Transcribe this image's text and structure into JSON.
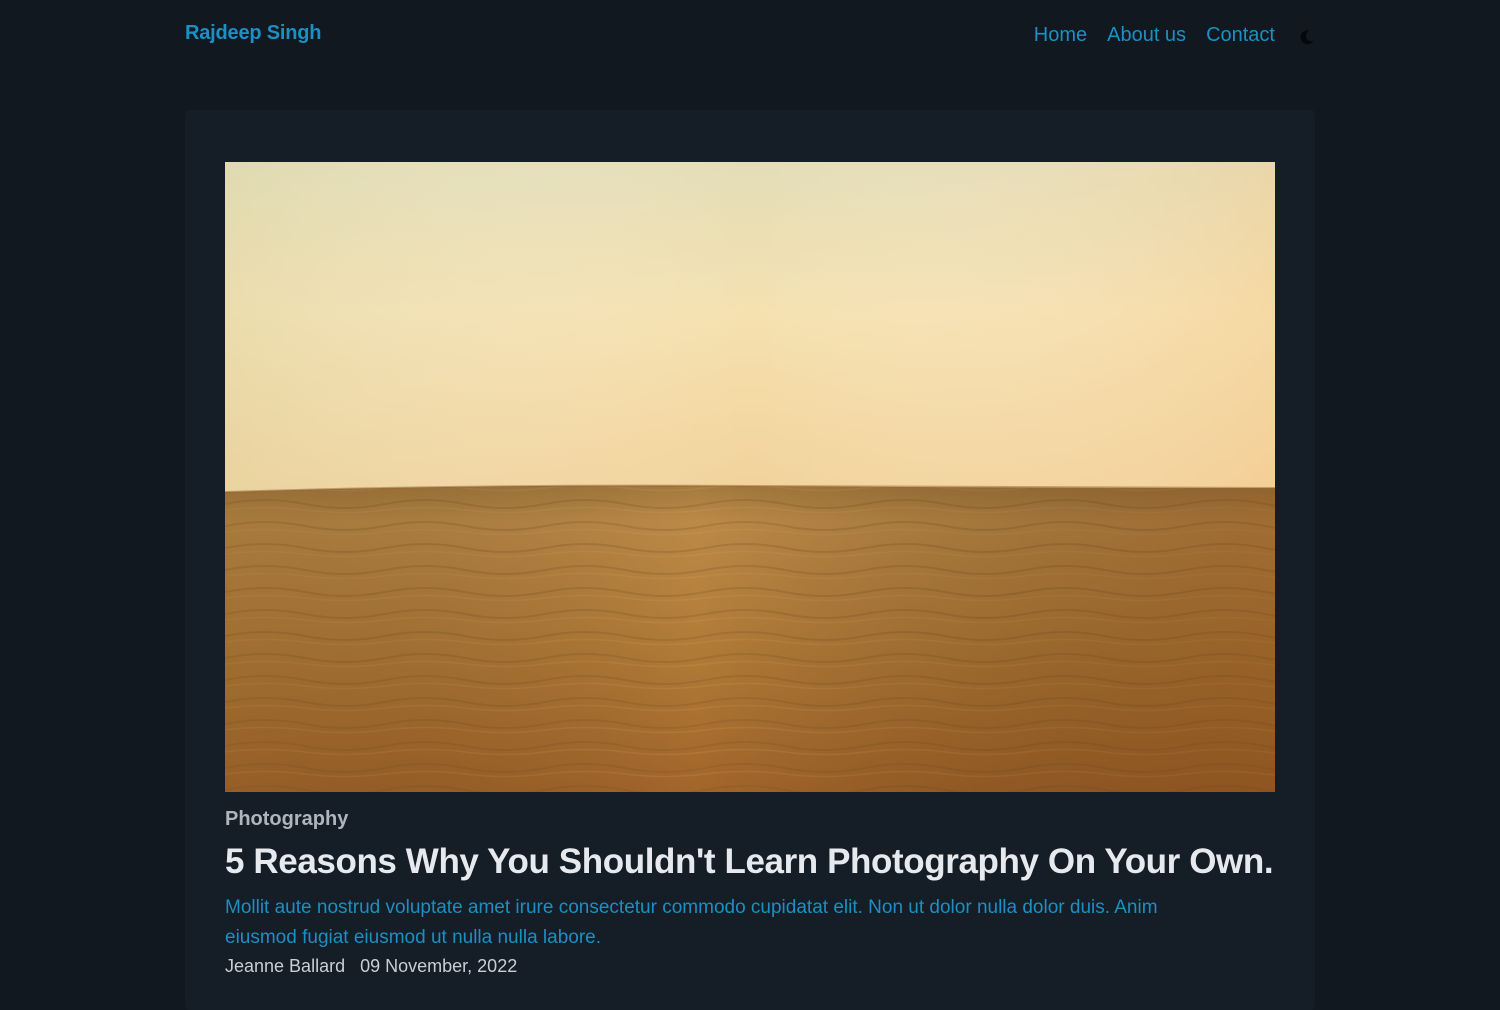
{
  "header": {
    "brand": "Rajdeep Singh",
    "nav": [
      {
        "label": "Home"
      },
      {
        "label": "About us"
      },
      {
        "label": "Contact"
      }
    ],
    "theme_toggle_icon": "moon-icon"
  },
  "post": {
    "image_icon": "desert-sand-dunes-photo",
    "category": "Photography",
    "title": "5 Reasons Why You Shouldn't Learn Photography On Your Own.",
    "excerpt": "Mollit aute nostrud voluptate amet irure consectetur commodo cupidatat elit. Non ut dolor nulla dolor duis. Anim eiusmod fugiat eiusmod ut nulla nulla labore.",
    "author": "Jeanne Ballard",
    "date": "09 November, 2022"
  },
  "colors": {
    "background": "#111820",
    "card": "#151d26",
    "accent": "#1c8fc4",
    "title": "#e6eaef",
    "muted": "#aeb5bd"
  }
}
